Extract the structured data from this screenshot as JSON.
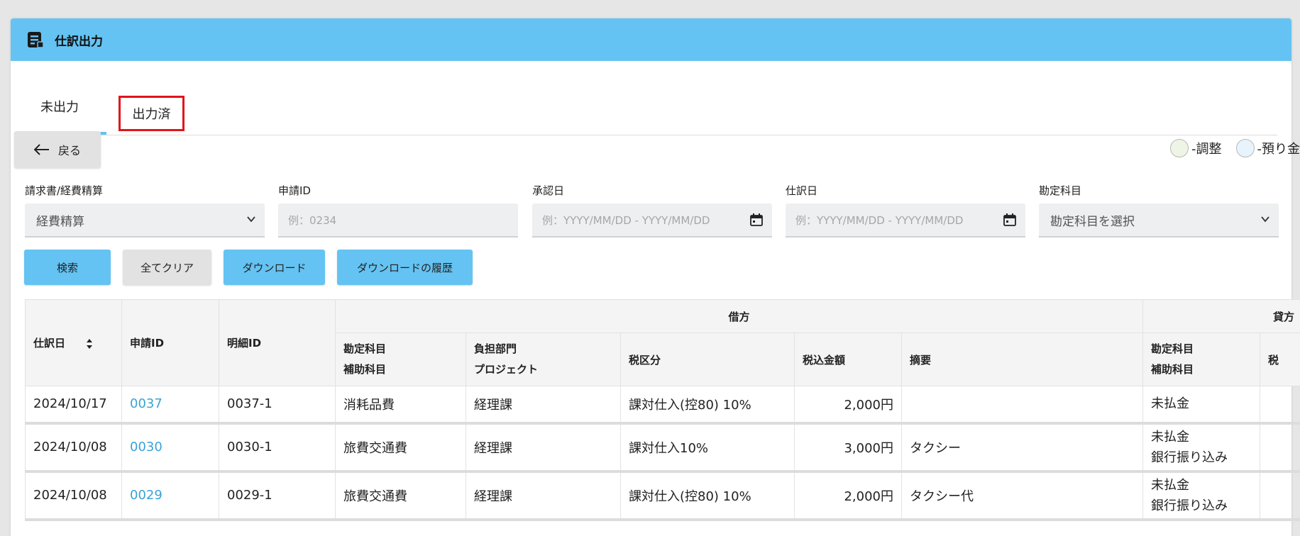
{
  "header": {
    "title": "仕訳出力"
  },
  "tabs": [
    {
      "label": "未出力",
      "active": true
    },
    {
      "label": "出力済",
      "active": false
    }
  ],
  "back_button": {
    "label": "戻る"
  },
  "legend": [
    {
      "label": "-調整",
      "color": "#eef5e6"
    },
    {
      "label": "-預り金",
      "color": "#e8f4fb"
    }
  ],
  "filters": {
    "type": {
      "label": "請求書/経費精算",
      "value": "経費精算"
    },
    "request_id": {
      "label": "申請ID",
      "placeholder": "例：0234"
    },
    "approval_date": {
      "label": "承認日",
      "placeholder": "例：YYYY/MM/DD - YYYY/MM/DD"
    },
    "journal_date": {
      "label": "仕訳日",
      "placeholder": "例：YYYY/MM/DD - YYYY/MM/DD"
    },
    "account": {
      "label": "勘定科目",
      "value": "勘定科目を選択"
    }
  },
  "buttons": {
    "search": "検索",
    "clear_all": "全てクリア",
    "download": "ダウンロード",
    "download_history": "ダウンロードの履歴"
  },
  "table": {
    "headers": {
      "journal_date": "仕訳日",
      "request_id": "申請ID",
      "detail_id": "明細ID",
      "debit": "借方",
      "credit": "貸方",
      "account": "勘定科目",
      "sub_account": "補助科目",
      "department": "負担部門",
      "project": "プロジェクト",
      "tax_category": "税区分",
      "amount": "税込金額",
      "summary": "摘要",
      "credit_tax_partial": "税"
    },
    "rows": [
      {
        "date": "2024/10/17",
        "request_id": "0037",
        "detail_id": "0037-1",
        "account": "消耗品費",
        "department": "経理課",
        "tax": "課対仕入(控80) 10%",
        "amount": "2,000円",
        "summary": "",
        "credit_account": "未払金",
        "credit_sub": ""
      },
      {
        "date": "2024/10/08",
        "request_id": "0030",
        "detail_id": "0030-1",
        "account": "旅費交通費",
        "department": "経理課",
        "tax": "課対仕入10%",
        "amount": "3,000円",
        "summary": "タクシー",
        "credit_account": "未払金",
        "credit_sub": "銀行振り込み"
      },
      {
        "date": "2024/10/08",
        "request_id": "0029",
        "detail_id": "0029-1",
        "account": "旅費交通費",
        "department": "経理課",
        "tax": "課対仕入(控80) 10%",
        "amount": "2,000円",
        "summary": "タクシー代",
        "credit_account": "未払金",
        "credit_sub": "銀行振り込み"
      }
    ]
  }
}
